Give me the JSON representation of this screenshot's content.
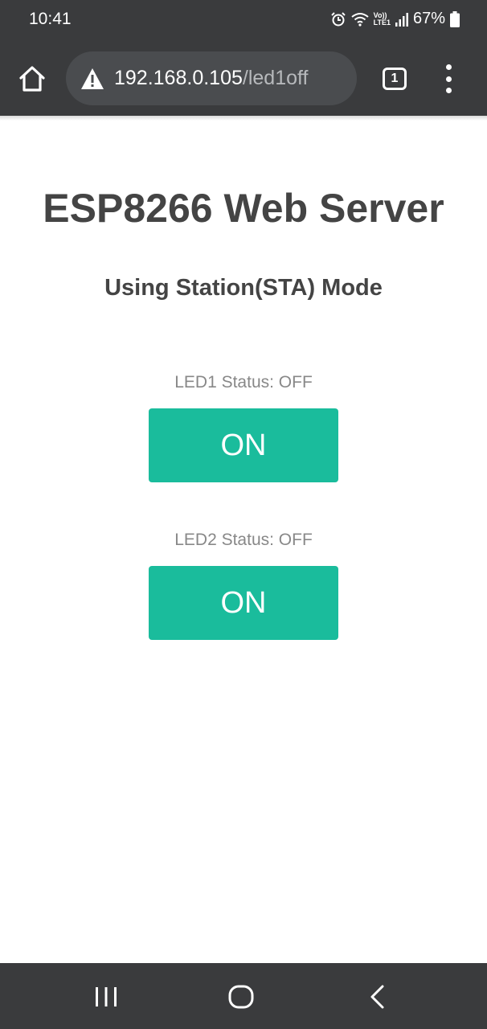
{
  "status_bar": {
    "time": "10:41",
    "network_label_top": "Vo))",
    "network_label_bottom": "LTE1",
    "battery": "67%",
    "icons": [
      "alarm-icon",
      "wifi-icon",
      "signal-icon",
      "battery-icon"
    ]
  },
  "browser": {
    "url_host": "192.168.0.105",
    "url_path": "/led1off",
    "tab_count": "1",
    "icons": [
      "home-icon",
      "not-secure-warning-icon",
      "tab-switcher-icon",
      "more-menu-icon"
    ]
  },
  "page": {
    "title": "ESP8266 Web Server",
    "subtitle": "Using Station(STA) Mode",
    "leds": [
      {
        "status": "LED1 Status: OFF",
        "button_label": "ON"
      },
      {
        "status": "LED2 Status: OFF",
        "button_label": "ON"
      }
    ],
    "button_color": "#1abc9c"
  },
  "nav_bar": {
    "icons": [
      "recent-apps-icon",
      "home-nav-icon",
      "back-icon"
    ]
  }
}
